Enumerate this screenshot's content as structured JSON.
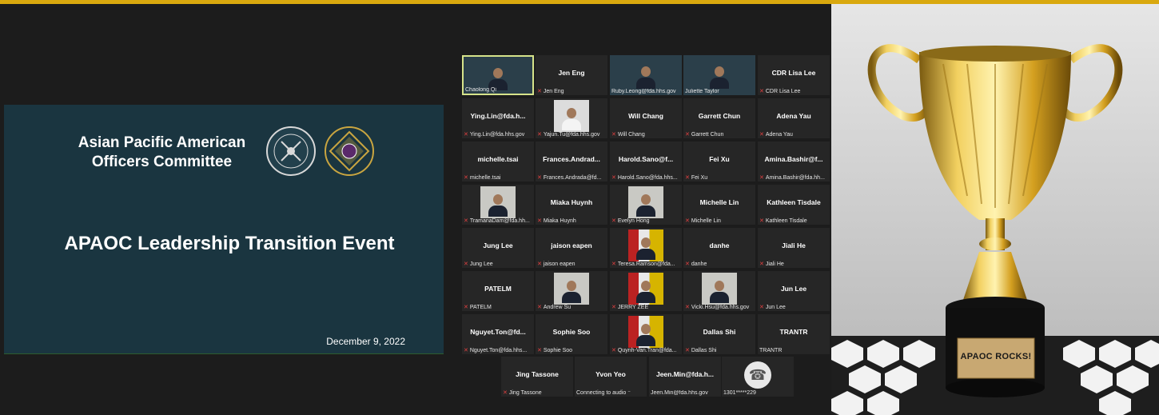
{
  "slide": {
    "org_name": "Asian Pacific American Officers Committee",
    "title": "APAOC Leadership Transition Event",
    "date": "December 9, 2022",
    "seal1_text": "U.S. PUBLIC HEALTH SERVICE 1798"
  },
  "gallery": {
    "tiles": [
      {
        "name": "",
        "label": "Chaolong Qi",
        "muted": false,
        "video": "banner",
        "active": true
      },
      {
        "name": "Jen Eng",
        "label": "Jen Eng",
        "muted": true,
        "video": "none"
      },
      {
        "name": "",
        "label": "Ruby.Leong@fda.hhs.gov",
        "muted": false,
        "video": "banner"
      },
      {
        "name": "",
        "label": "Juliette Taylor",
        "muted": false,
        "video": "banner"
      },
      {
        "name": "CDR Lisa Lee",
        "label": "CDR Lisa Lee",
        "muted": true,
        "video": "none"
      },
      {
        "name": "Ying.Lin@fda.h...",
        "label": "Ying.Lin@fda.hhs.gov",
        "muted": true,
        "video": "none"
      },
      {
        "name": "",
        "label": "Yajun.Tu@fda.hhs.gov",
        "muted": true,
        "video": "uniform"
      },
      {
        "name": "Will Chang",
        "label": "Will Chang",
        "muted": true,
        "video": "none"
      },
      {
        "name": "Garrett Chun",
        "label": "Garrett Chun",
        "muted": true,
        "video": "none"
      },
      {
        "name": "Adena Yau",
        "label": "Adena Yau",
        "muted": true,
        "video": "none"
      },
      {
        "name": "michelle.tsai",
        "label": "michelle.tsai",
        "muted": true,
        "video": "none"
      },
      {
        "name": "Frances.Andrad...",
        "label": "Frances.Andrada@fd...",
        "muted": true,
        "video": "none"
      },
      {
        "name": "Harold.Sano@f...",
        "label": "Harold.Sano@fda.hhs...",
        "muted": true,
        "video": "none"
      },
      {
        "name": "Fei Xu",
        "label": "Fei Xu",
        "muted": true,
        "video": "none"
      },
      {
        "name": "Amina.Bashir@f...",
        "label": "Amina.Bashir@fda.hh...",
        "muted": true,
        "video": "none"
      },
      {
        "name": "",
        "label": "TramanaDam@fda.hh...",
        "muted": true,
        "video": "photo"
      },
      {
        "name": "Miaka Huynh",
        "label": "Miaka Huynh",
        "muted": true,
        "video": "none"
      },
      {
        "name": "",
        "label": "Evelyn Hong",
        "muted": true,
        "video": "photo"
      },
      {
        "name": "Michelle Lin",
        "label": "Michelle Lin",
        "muted": true,
        "video": "none"
      },
      {
        "name": "Kathleen Tisdale",
        "label": "Kathleen Tisdale",
        "muted": true,
        "video": "none"
      },
      {
        "name": "Jung Lee",
        "label": "Jung Lee",
        "muted": true,
        "video": "none"
      },
      {
        "name": "jaison eapen",
        "label": "jaison eapen",
        "muted": true,
        "video": "none"
      },
      {
        "name": "",
        "label": "Teresa.Ramson@fda...",
        "muted": true,
        "video": "flags"
      },
      {
        "name": "danhe",
        "label": "danhe",
        "muted": true,
        "video": "none"
      },
      {
        "name": "Jiali He",
        "label": "Jiali He",
        "muted": true,
        "video": "none"
      },
      {
        "name": "PATELM",
        "label": "PATELM",
        "muted": true,
        "video": "none"
      },
      {
        "name": "",
        "label": "Andrew Su",
        "muted": true,
        "video": "photo"
      },
      {
        "name": "",
        "label": "JERRY ZEE",
        "muted": true,
        "video": "flags"
      },
      {
        "name": "",
        "label": "Vicki.Hsu@fda.hhs.gov",
        "muted": true,
        "video": "photo"
      },
      {
        "name": "Jun Lee",
        "label": "Jun Lee",
        "muted": true,
        "video": "none"
      },
      {
        "name": "Nguyet.Ton@fd...",
        "label": "Nguyet.Ton@fda.hhs...",
        "muted": true,
        "video": "none"
      },
      {
        "name": "Sophie Soo",
        "label": "Sophie Soo",
        "muted": true,
        "video": "none"
      },
      {
        "name": "",
        "label": "Quynh-Van.Tran@fda...",
        "muted": true,
        "video": "flags"
      },
      {
        "name": "Dallas Shi",
        "label": "Dallas Shi",
        "muted": true,
        "video": "none"
      },
      {
        "name": "TRANTR",
        "label": "TRANTR",
        "muted": false,
        "video": "none"
      },
      {
        "name": "Jing Tassone",
        "label": "Jing Tassone",
        "muted": true,
        "video": "none"
      },
      {
        "name": "Yvon Yeo",
        "label": "Connecting to audio ⁻",
        "muted": false,
        "video": "none"
      },
      {
        "name": "Jeen.Min@fda.h...",
        "label": "Jeen.Min@fda.hhs.gov",
        "muted": false,
        "video": "none"
      },
      {
        "name": "",
        "label": "1301*****229",
        "muted": false,
        "video": "phone"
      }
    ]
  },
  "trophy": {
    "plate": "APAOC ROCKS!"
  },
  "colors": {
    "accent_bar": "#d9a80e",
    "slide_bg": "#1a3540",
    "tile_bg": "#262626",
    "active_border": "#d6e38a",
    "mute_icon": "#e04040"
  }
}
